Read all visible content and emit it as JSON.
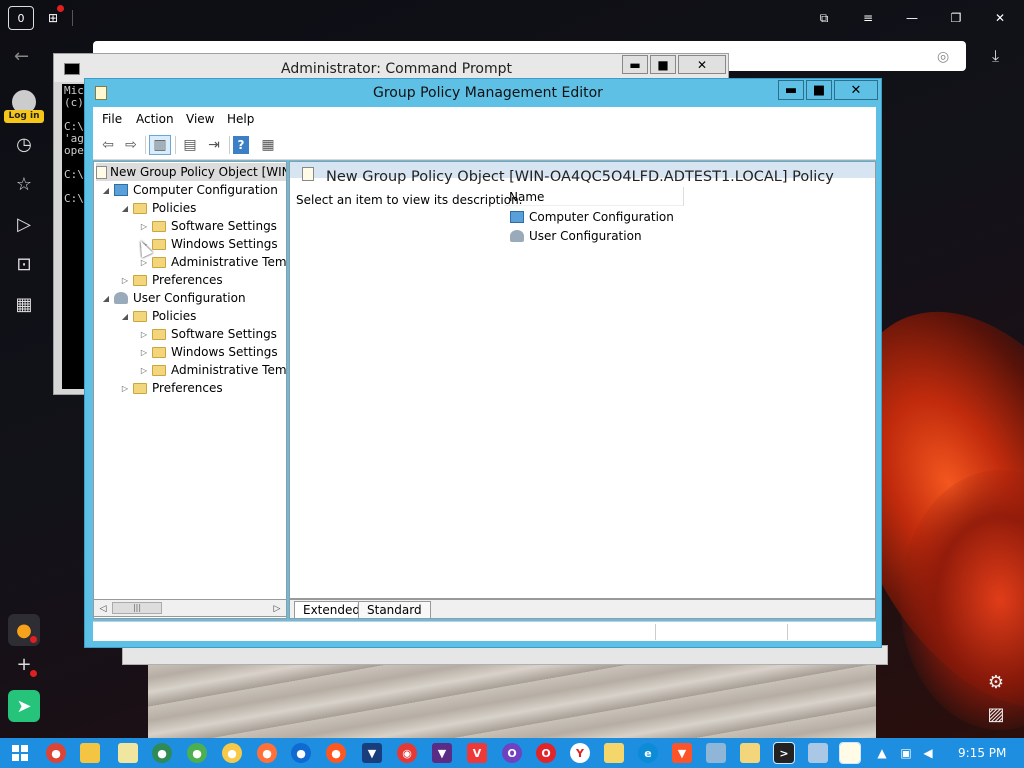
{
  "browser": {
    "tab_count": "0",
    "login_label": "Log in"
  },
  "cmd_window": {
    "title": "Administrator: Command Prompt",
    "lines": [
      "Mic",
      "(c)",
      "C:\\",
      "'ag",
      "ope",
      "C:\\",
      "C:\\"
    ],
    "buttons": {
      "minimize": "▬",
      "maximize": "■",
      "close": "✕"
    }
  },
  "gpe": {
    "title": "Group Policy Management Editor",
    "buttons": {
      "minimize": "▬",
      "maximize": "■",
      "close": "✕"
    },
    "menu": [
      "File",
      "Action",
      "View",
      "Help"
    ],
    "tree": {
      "root": "New Group Policy Object [WIN-",
      "items": [
        {
          "label": "Computer Configuration"
        },
        {
          "label": "Policies"
        },
        {
          "label": "Software Settings"
        },
        {
          "label": "Windows Settings"
        },
        {
          "label": "Administrative Temp"
        },
        {
          "label": "Preferences"
        },
        {
          "label": "User Configuration"
        },
        {
          "label": "Policies"
        },
        {
          "label": "Software Settings"
        },
        {
          "label": "Windows Settings"
        },
        {
          "label": "Administrative Temp"
        },
        {
          "label": "Preferences"
        }
      ]
    },
    "right_pane": {
      "header": "New Group Policy Object [WIN-OA4QC5O4LFD.ADTEST1.LOCAL] Policy",
      "description": "Select an item to view its description.",
      "column_name": "Name",
      "items": [
        "Computer Configuration",
        "User Configuration"
      ]
    },
    "tabs": [
      "Extended",
      "Standard"
    ]
  },
  "taskbar": {
    "clock": "9:15 PM"
  }
}
